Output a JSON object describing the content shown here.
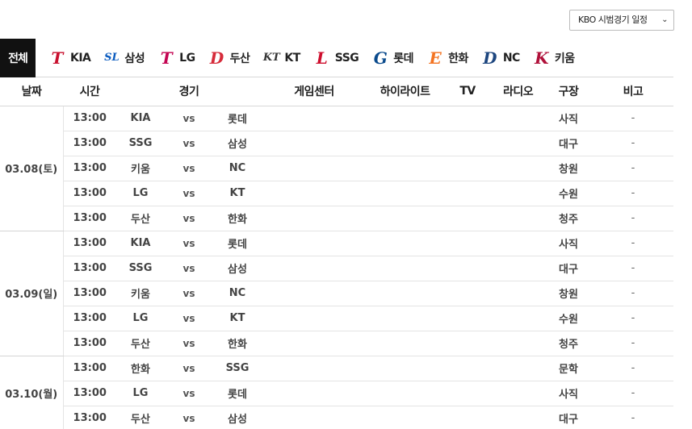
{
  "schedule_select": {
    "selected": "KBO 시범경기 일정"
  },
  "tabs": {
    "all_label": "전체",
    "teams": [
      {
        "label": "KIA",
        "icon": "kia-tigers-logo-icon",
        "color": "#c8102e",
        "glyph": "T"
      },
      {
        "label": "삼성",
        "icon": "samsung-lions-logo-icon",
        "color": "#0a5bbf",
        "glyph": "SL"
      },
      {
        "label": "LG",
        "icon": "lg-twins-logo-icon",
        "color": "#c30452",
        "glyph": "T"
      },
      {
        "label": "두산",
        "icon": "doosan-bears-logo-icon",
        "color": "#d62b3a",
        "glyph": "D"
      },
      {
        "label": "KT",
        "icon": "kt-wiz-logo-icon",
        "color": "#333333",
        "glyph": "KT"
      },
      {
        "label": "SSG",
        "icon": "ssg-landers-logo-icon",
        "color": "#ce0e2d",
        "glyph": "L"
      },
      {
        "label": "롯데",
        "icon": "lotte-giants-logo-icon",
        "color": "#0a4a8c",
        "glyph": "G"
      },
      {
        "label": "한화",
        "icon": "hanwha-eagles-logo-icon",
        "color": "#f37321",
        "glyph": "E"
      },
      {
        "label": "NC",
        "icon": "nc-dinos-logo-icon",
        "color": "#1d467f",
        "glyph": "D"
      },
      {
        "label": "키움",
        "icon": "kiwoom-heroes-logo-icon",
        "color": "#b0113a",
        "glyph": "K"
      }
    ]
  },
  "table": {
    "headers": [
      "날짜",
      "시간",
      "경기",
      "게임센터",
      "하이라이트",
      "TV",
      "라디오",
      "구장",
      "비고"
    ],
    "vs_label": "vs",
    "days": [
      {
        "date": "03.08(토)",
        "games": [
          {
            "time": "13:00",
            "away": "KIA",
            "home": "롯데",
            "stadium": "사직",
            "note": "-"
          },
          {
            "time": "13:00",
            "away": "SSG",
            "home": "삼성",
            "stadium": "대구",
            "note": "-"
          },
          {
            "time": "13:00",
            "away": "키움",
            "home": "NC",
            "stadium": "창원",
            "note": "-"
          },
          {
            "time": "13:00",
            "away": "LG",
            "home": "KT",
            "stadium": "수원",
            "note": "-"
          },
          {
            "time": "13:00",
            "away": "두산",
            "home": "한화",
            "stadium": "청주",
            "note": "-"
          }
        ]
      },
      {
        "date": "03.09(일)",
        "games": [
          {
            "time": "13:00",
            "away": "KIA",
            "home": "롯데",
            "stadium": "사직",
            "note": "-"
          },
          {
            "time": "13:00",
            "away": "SSG",
            "home": "삼성",
            "stadium": "대구",
            "note": "-"
          },
          {
            "time": "13:00",
            "away": "키움",
            "home": "NC",
            "stadium": "창원",
            "note": "-"
          },
          {
            "time": "13:00",
            "away": "LG",
            "home": "KT",
            "stadium": "수원",
            "note": "-"
          },
          {
            "time": "13:00",
            "away": "두산",
            "home": "한화",
            "stadium": "청주",
            "note": "-"
          }
        ]
      },
      {
        "date": "03.10(월)",
        "games": [
          {
            "time": "13:00",
            "away": "한화",
            "home": "SSG",
            "stadium": "문학",
            "note": "-"
          },
          {
            "time": "13:00",
            "away": "LG",
            "home": "롯데",
            "stadium": "사직",
            "note": "-"
          },
          {
            "time": "13:00",
            "away": "두산",
            "home": "삼성",
            "stadium": "대구",
            "note": "-"
          }
        ]
      }
    ]
  }
}
